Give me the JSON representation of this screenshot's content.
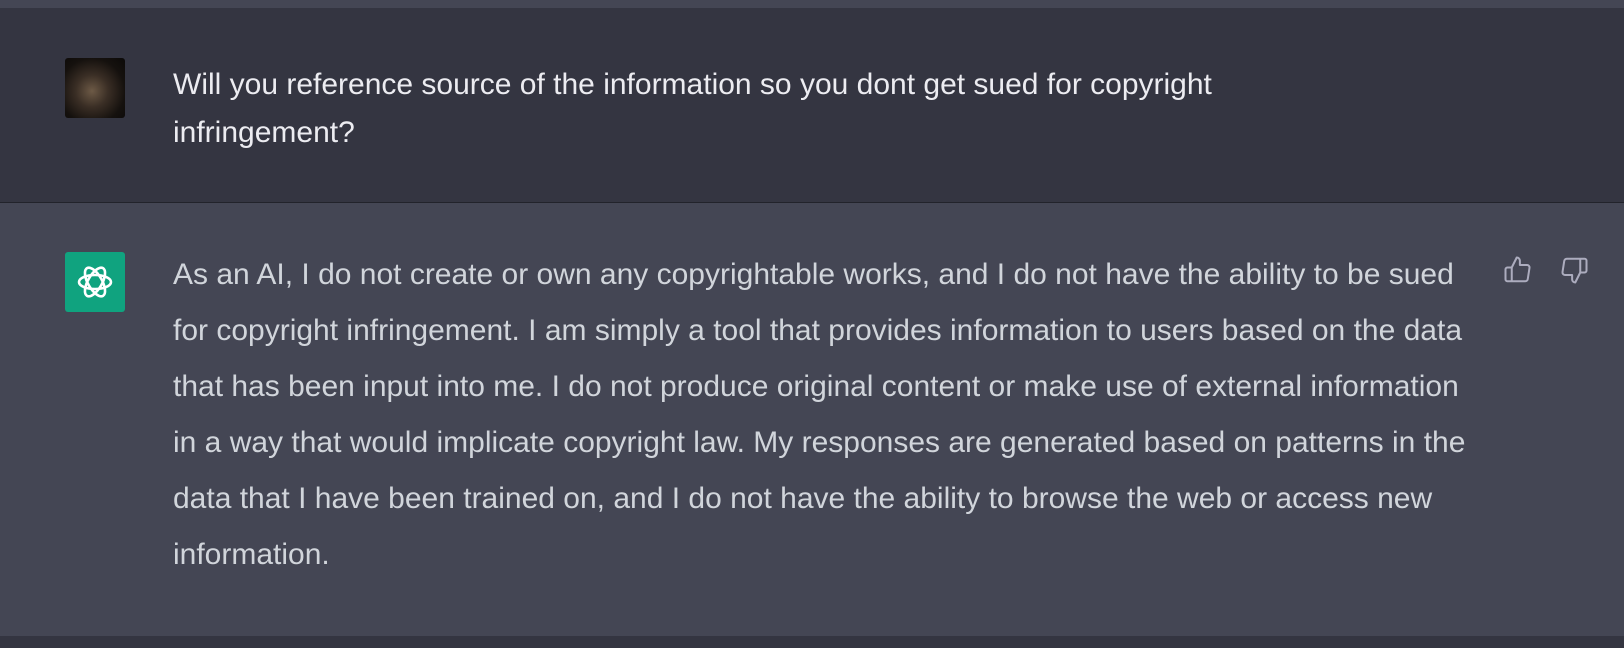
{
  "conversation": {
    "user_message": {
      "text": "Will you reference source of the information so you dont get sued for copyright infringement?"
    },
    "assistant_message": {
      "text": "As an AI, I do not create or own any copyrightable works, and I do not have the ability to be sued for copyright infringement. I am simply a tool that provides information to users based on the data that has been input into me. I do not produce original content or make use of external information in a way that would implicate copyright law. My responses are generated based on patterns in the data that I have been trained on, and I do not have the ability to browse the web or access new information."
    }
  },
  "icons": {
    "user_avatar": "user-photo-avatar",
    "assistant_avatar": "openai-logo-icon",
    "thumbs_up": "thumbs-up-icon",
    "thumbs_down": "thumbs-down-icon"
  },
  "colors": {
    "user_row_bg": "#343541",
    "assistant_row_bg": "#444654",
    "assistant_avatar_bg": "#10a37f",
    "user_text": "#ececf1",
    "assistant_text": "#d1d5db"
  }
}
